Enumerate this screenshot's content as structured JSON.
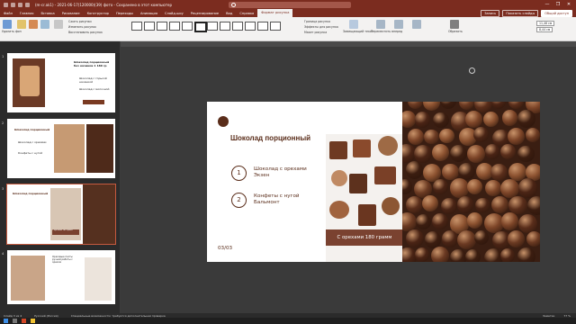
{
  "window": {
    "title": "(m-cr.ak1) - 2021-06-17(120000)(39) фото - Сохранено в этот компьютер",
    "search_placeholder": "",
    "controls": [
      "—",
      "❐",
      "✕"
    ]
  },
  "menu": {
    "tabs": [
      "Файл",
      "Главная",
      "Вставка",
      "Рисование",
      "Конструктор",
      "Переходы",
      "Анимация",
      "Слайд-шоу",
      "Рецензирование",
      "Вид",
      "Справка",
      "Формат рисунка"
    ],
    "active": "Формат рисунка",
    "right_buttons": [
      "Запись",
      "Показать слайды",
      "Общий доступ"
    ]
  },
  "ribbon": {
    "groups": [
      "Изменение",
      "Стили рисунков",
      "Специальные возможности",
      "Упорядочение",
      "Размер"
    ],
    "buttons": {
      "remove_bg": "Удалить фон",
      "corrections": "Коррекция",
      "color": "Цвет",
      "artistic": "Художественные эффекты",
      "transparency": "Прозрачность",
      "compress": "Сжать рисунки",
      "change_picture": "Изменить рисунок",
      "reset": "Восстановить рисунок",
      "border": "Граница рисунка",
      "effects": "Эффекты для рисунка",
      "layout": "Макет рисунка",
      "alt_text": "Замещающий текст",
      "bring_forward": "Переместить вперед",
      "send_backward": "Переместить назад",
      "selection_pane": "Область выделения",
      "crop": "Обрезать",
      "height": "11,46 см",
      "width": "8,44 см"
    }
  },
  "thumbnails": [
    {
      "num": "1",
      "title": "Шоколад порционный без начинки 1 180 гр",
      "item1": "Шоколад с горькой начинкой",
      "item2": "Шоколад с молочной"
    },
    {
      "num": "2",
      "title": "Шоколад порционный",
      "item1": "Шоколад с орехами",
      "item2": "Конфеты с нугой"
    },
    {
      "num": "3",
      "title": "Шоколад порционный",
      "item1": "",
      "item2": "",
      "badge": "С орехами 180 грамм"
    },
    {
      "num": "4",
      "title": "Ореховые пасты ручной работы с орехом",
      "item1": "",
      "item2": ""
    }
  ],
  "slide": {
    "title": "Шоколад порционный",
    "items": [
      {
        "num": "1",
        "text": "Шоколад с орехами Экзен"
      },
      {
        "num": "2",
        "text": "Конфеты с нугой Бальмонт"
      }
    ],
    "badge": "С орехами 180 грамм",
    "page": "03/03",
    "brand_color": "#5a2d1a",
    "accent_color": "#7a4230"
  },
  "status": {
    "slide_info": "Слайд 3 из 4",
    "language": "Русский (Россия)",
    "accessibility": "Специальные возможности: требуется дополнительная проверка",
    "notes": "Заметки",
    "zoom": "77 %"
  }
}
